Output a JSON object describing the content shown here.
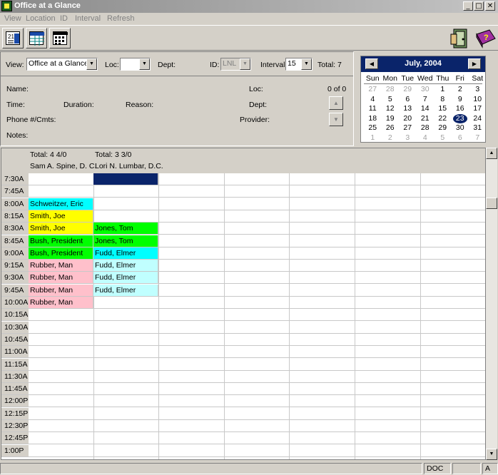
{
  "window": {
    "title": "Office at a Glance"
  },
  "menu": [
    "View",
    "Location",
    "ID",
    "Interval",
    "Refresh"
  ],
  "form": {
    "view_label": "View:",
    "view_value": "Office at a Glance",
    "loc_label": "Loc:",
    "loc_value": "",
    "dept_label": "Dept:",
    "id_label": "ID:",
    "id_value": "LNL",
    "interval_label": "Interval:",
    "interval_value": "15",
    "total_label": "Total: 7",
    "name_label": "Name:",
    "loc2_label": "Loc:",
    "count": "0 of 0",
    "time_label": "Time:",
    "duration_label": "Duration:",
    "reason_label": "Reason:",
    "dept2_label": "Dept:",
    "phone_label": "Phone #/Cmts:",
    "provider_label": "Provider:",
    "notes_label": "Notes:"
  },
  "calendar": {
    "month_title": "July, 2004",
    "dow": [
      "Sun",
      "Mon",
      "Tue",
      "Wed",
      "Thu",
      "Fri",
      "Sat"
    ],
    "weeks": [
      [
        "27",
        "28",
        "29",
        "30",
        "1",
        "2",
        "3"
      ],
      [
        "4",
        "5",
        "6",
        "7",
        "8",
        "9",
        "10"
      ],
      [
        "11",
        "12",
        "13",
        "14",
        "15",
        "16",
        "17"
      ],
      [
        "18",
        "19",
        "20",
        "21",
        "22",
        "23",
        "24"
      ],
      [
        "25",
        "26",
        "27",
        "28",
        "29",
        "30",
        "31"
      ],
      [
        "1",
        "2",
        "3",
        "4",
        "5",
        "6",
        "7"
      ]
    ],
    "selected": "23"
  },
  "columns": [
    {
      "total": "Total:  4  4/0",
      "provider": "Sam A. Spine, D. C."
    },
    {
      "total": "Total:  3  3/0",
      "provider": "Lori N. Lumbar, D.C."
    }
  ],
  "times": [
    "7:30A",
    "7:45A",
    "8:00A",
    "8:15A",
    "8:30A",
    "8:45A",
    "9:00A",
    "9:15A",
    "9:30A",
    "9:45A",
    "10:00A",
    "10:15A",
    "10:30A",
    "10:45A",
    "11:00A",
    "11:15A",
    "11:30A",
    "11:45A",
    "12:00P",
    "12:15P",
    "12:30P",
    "12:45P",
    "1:00P"
  ],
  "appointments": [
    {
      "col": 0,
      "row": 2,
      "name": "Schweitzer, Eric",
      "color": "#00ffff"
    },
    {
      "col": 0,
      "row": 3,
      "name": "Smith, Joe",
      "color": "#ffff00"
    },
    {
      "col": 0,
      "row": 4,
      "name": "Smith, Joe",
      "color": "#ffff00"
    },
    {
      "col": 0,
      "row": 5,
      "name": "Bush, President",
      "color": "#00ff00"
    },
    {
      "col": 0,
      "row": 6,
      "name": "Bush, President",
      "color": "#00ff00"
    },
    {
      "col": 0,
      "row": 7,
      "name": "Rubber, Man",
      "color": "#ffc0cb"
    },
    {
      "col": 0,
      "row": 8,
      "name": "Rubber, Man",
      "color": "#ffc0cb"
    },
    {
      "col": 0,
      "row": 9,
      "name": "Rubber, Man",
      "color": "#ffc0cb"
    },
    {
      "col": 0,
      "row": 10,
      "name": "Rubber, Man",
      "color": "#ffc0cb"
    },
    {
      "col": 1,
      "row": 0,
      "name": "",
      "color": "#0a246a"
    },
    {
      "col": 1,
      "row": 4,
      "name": "Jones, Tom",
      "color": "#00ff00"
    },
    {
      "col": 1,
      "row": 5,
      "name": "Jones, Tom",
      "color": "#00ff00"
    },
    {
      "col": 1,
      "row": 6,
      "name": "Fudd, Elmer",
      "color": "#00ffff"
    },
    {
      "col": 1,
      "row": 7,
      "name": "Fudd, Elmer",
      "color": "#c0ffff"
    },
    {
      "col": 1,
      "row": 8,
      "name": "Fudd, Elmer",
      "color": "#c0ffff"
    },
    {
      "col": 1,
      "row": 9,
      "name": "Fudd, Elmer",
      "color": "#c0ffff"
    }
  ],
  "status": {
    "pane1": "",
    "pane2": "DOC",
    "pane3": "",
    "pane4": "A"
  },
  "icons": {
    "toolbar": [
      "date-list-icon",
      "grid-view-icon",
      "calendar-grid-icon"
    ],
    "right": [
      "exit-door-icon",
      "help-book-icon"
    ]
  }
}
